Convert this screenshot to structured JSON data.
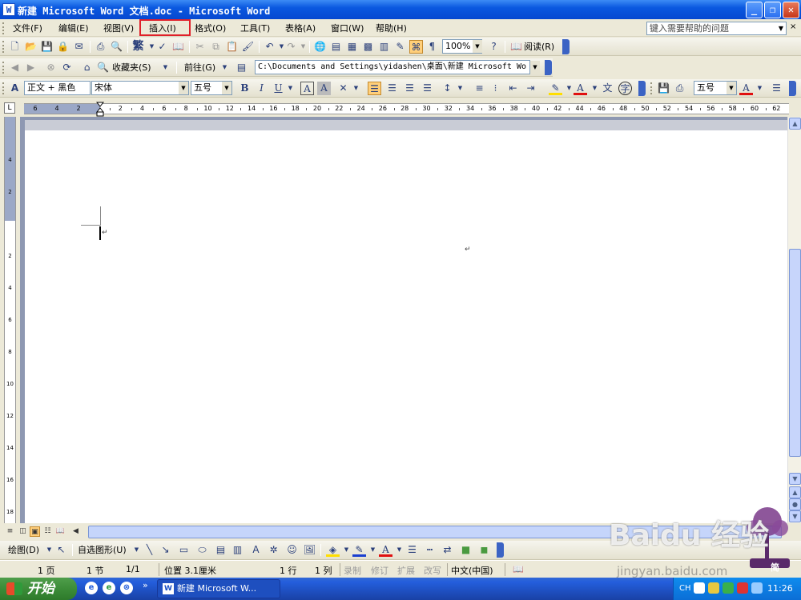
{
  "window": {
    "title": "新建 Microsoft Word 文档.doc - Microsoft Word",
    "icon": "W",
    "minimize": "_",
    "maximize": "❐",
    "close": "✕"
  },
  "menubar": {
    "items": [
      {
        "label": "文件(F)"
      },
      {
        "label": "编辑(E)"
      },
      {
        "label": "视图(V)"
      },
      {
        "label": "插入(I)"
      },
      {
        "label": "格式(O)"
      },
      {
        "label": "工具(T)"
      },
      {
        "label": "表格(A)"
      },
      {
        "label": "窗口(W)"
      },
      {
        "label": "帮助(H)"
      }
    ],
    "highlight_color": "#e0202a",
    "help_placeholder": "键入需要帮助的问题",
    "help_close": "×"
  },
  "standard_toolbar": {
    "zoom": "100%",
    "read_label": "阅读(R)",
    "fan_label": "繁"
  },
  "web_toolbar": {
    "favorites_label": "收藏夹(S)",
    "goto_label": "前往(G)",
    "address": "C:\\Documents and Settings\\yidashen\\桌面\\新建 Microsoft Wo"
  },
  "format_toolbar": {
    "style": "正文 + 黑色",
    "font": "宋体",
    "size": "五号",
    "size2": "五号"
  },
  "ruler": {
    "corner": "L",
    "h_left_labels": [
      "6",
      "4",
      "2"
    ],
    "h_right_labels": [
      "2",
      "4",
      "6",
      "8",
      "10",
      "12",
      "14",
      "16",
      "18",
      "20",
      "22",
      "24",
      "26",
      "28",
      "30",
      "32",
      "34",
      "36",
      "38",
      "40",
      "42",
      "44",
      "46",
      "48",
      "50",
      "52",
      "54",
      "56",
      "58",
      "60",
      "62"
    ],
    "v_labels": [
      "4",
      "2",
      "",
      "2",
      "4",
      "6",
      "8",
      "10",
      "12",
      "14",
      "16",
      "18"
    ]
  },
  "document": {
    "para_mark_1": "↵",
    "para_mark_2": "↵"
  },
  "drawing_toolbar": {
    "draw_label": "绘图(D)",
    "autoshapes_label": "自选图形(U)"
  },
  "statusbar": {
    "page": "1 页",
    "section": "1 节",
    "page_of": "1/1",
    "position": "位置 3.1厘米",
    "line": "1 行",
    "column": "1 列",
    "rec": "录制",
    "trk": "修订",
    "ext": "扩展",
    "ovr": "改写",
    "language": "中文(中国)"
  },
  "taskbar": {
    "start_label": "开始",
    "task_label": "新建 Microsoft W...",
    "lang": "CH",
    "time": "11:26",
    "ql_more": "»"
  },
  "watermark": {
    "brand": "Baidu 经验",
    "url": "jingyan.baidu.com",
    "badge": "简"
  }
}
